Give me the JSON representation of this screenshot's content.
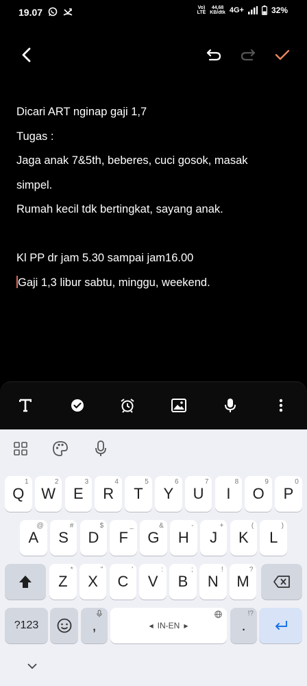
{
  "status": {
    "time": "19.07",
    "volte": "Vo)\nLTE",
    "speed_value": "44,68",
    "speed_unit": "KB/dtk",
    "network": "4G+",
    "battery": "32%"
  },
  "note": {
    "lines": [
      "Dicari ART nginap gaji 1,7",
      "Tugas :",
      "Jaga anak 7&5th, beberes, cuci gosok, masak",
      "simpel.",
      "Rumah kecil tdk bertingkat, sayang anak.",
      "",
      "Kl PP dr jam 5.30 sampai jam16.00",
      "Gaji 1,3 libur sabtu, minggu, weekend."
    ]
  },
  "keyboard": {
    "row1": [
      {
        "k": "Q",
        "h": "1"
      },
      {
        "k": "W",
        "h": "2"
      },
      {
        "k": "E",
        "h": "3"
      },
      {
        "k": "R",
        "h": "4"
      },
      {
        "k": "T",
        "h": "5"
      },
      {
        "k": "Y",
        "h": "6"
      },
      {
        "k": "U",
        "h": "7"
      },
      {
        "k": "I",
        "h": "8"
      },
      {
        "k": "O",
        "h": "9"
      },
      {
        "k": "P",
        "h": "0"
      }
    ],
    "row2": [
      {
        "k": "A",
        "h": "@"
      },
      {
        "k": "S",
        "h": "#"
      },
      {
        "k": "D",
        "h": "$"
      },
      {
        "k": "F",
        "h": "_"
      },
      {
        "k": "G",
        "h": "&"
      },
      {
        "k": "H",
        "h": "-"
      },
      {
        "k": "J",
        "h": "+"
      },
      {
        "k": "K",
        "h": "("
      },
      {
        "k": "L",
        "h": ")"
      }
    ],
    "row3": [
      {
        "k": "Z",
        "h": "*"
      },
      {
        "k": "X",
        "h": "\""
      },
      {
        "k": "C",
        "h": "'"
      },
      {
        "k": "V",
        "h": ":"
      },
      {
        "k": "B",
        "h": ";"
      },
      {
        "k": "N",
        "h": "!"
      },
      {
        "k": "M",
        "h": "?"
      }
    ],
    "symbols_key": "?123",
    "comma_key": ",",
    "space_label": "IN-EN",
    "period_key": ".",
    "period_hint": "!?"
  }
}
